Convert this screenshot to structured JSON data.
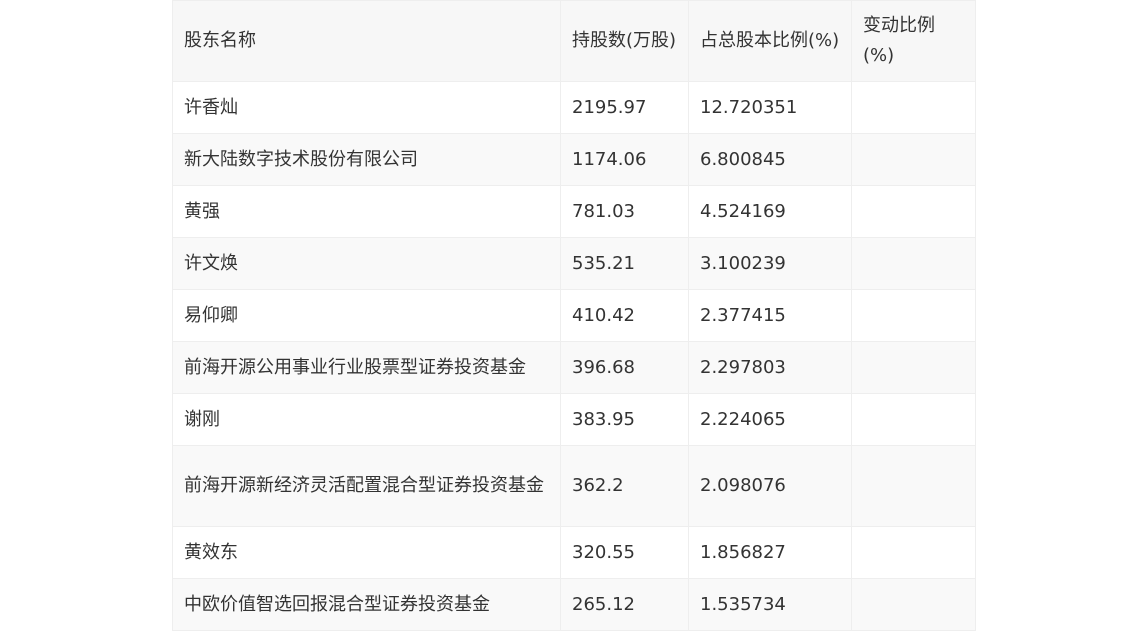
{
  "table": {
    "headers": [
      "股东名称",
      "持股数(万股)",
      "占总股本比例(%)",
      "变动比例(%)"
    ],
    "rows": [
      [
        "许香灿",
        "2195.97",
        "12.720351",
        ""
      ],
      [
        "新大陆数字技术股份有限公司",
        "1174.06",
        "6.800845",
        ""
      ],
      [
        "黄强",
        "781.03",
        "4.524169",
        ""
      ],
      [
        "许文焕",
        "535.21",
        "3.100239",
        ""
      ],
      [
        "易仰卿",
        "410.42",
        "2.377415",
        ""
      ],
      [
        "前海开源公用事业行业股票型证券投资基金",
        "396.68",
        "2.297803",
        ""
      ],
      [
        "谢刚",
        "383.95",
        "2.224065",
        ""
      ],
      [
        "前海开源新经济灵活配置混合型证券投资基金",
        "362.2",
        "2.098076",
        ""
      ],
      [
        "黄效东",
        "320.55",
        "1.856827",
        ""
      ],
      [
        "中欧价值智选回报混合型证券投资基金",
        "265.12",
        "1.535734",
        ""
      ]
    ]
  }
}
